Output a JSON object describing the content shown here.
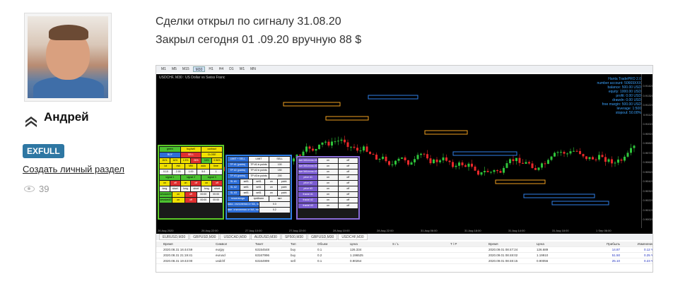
{
  "author": {
    "name": "Андрей",
    "badge": "EXFULL",
    "create_section_link": "Создать личный раздел",
    "views": "39"
  },
  "post": {
    "line1": "Сделки открыл по сигналу 31.08.20",
    "line2": "Закрыл сегодня 01 .09.20 вручную 88 $"
  },
  "terminal": {
    "timeframes": [
      "M1",
      "M5",
      "M15",
      "M30",
      "H1",
      "H4",
      "D1",
      "W1",
      "MN"
    ],
    "active_timeframe": "M30",
    "chart_title": "USDCHF, M30 : US Dollar vs Swiss Franc",
    "account_info": [
      "Hanta TradePRO 2.0",
      "number account: 50669XXX",
      "balance: 500.00 USD",
      "equity: 1000.00 USD",
      "profit: 0.00 USD",
      "drawdn: 0.00 USD",
      "free margin: 500.00 USD",
      "leverage: 1:500",
      "stopout: 50.00%"
    ],
    "y_ticks": [
      "0.91420",
      "0.91320",
      "0.91220",
      "0.91120",
      "0.91020",
      "0.90920",
      "0.90820",
      "0.90720",
      "0.90620",
      "0.90520",
      "0.90420",
      "0.90320",
      "0.90220",
      "0.90120",
      "0.90020"
    ],
    "x_ticks": [
      "26 Aug 2020",
      "26 Aug 22:00",
      "27 Aug 10:00",
      "27 Aug 22:00",
      "28 Aug 10:00",
      "28 Aug 22:00",
      "31 Aug 06:00",
      "31 Aug 18:00",
      "31 Aug 14:00",
      "31 Aug 18:00",
      "1 Sep 06:00"
    ],
    "symbol_tabs": [
      "EURUSD,M30",
      "GBPUSD,M30",
      "USDCAD,M30",
      "AUDUSD,M30",
      "SP500,M30",
      "GBPUSD,M30",
      "USDCHF,M30"
    ],
    "active_symbol_tab": "USDCHF,M30",
    "trades_header": [
      "Время",
      "Символ",
      "Тикет",
      "Тип",
      "Объем",
      "Цена",
      "S / L",
      "T / P",
      "Время",
      "Цена",
      "Прибыль",
      "Изменение"
    ],
    "trades": [
      [
        "2020.08.31 16:44:59",
        "eurjpy",
        "63154548",
        "buy",
        "0.1",
        "126.334",
        "",
        "",
        "2020.09.01 08:47:24",
        "126.689",
        "14.87",
        "0.12 %"
      ],
      [
        "2020.08.31 21:19:41",
        "eurusd",
        "63167996",
        "buy",
        "0.2",
        "1.196525",
        "",
        "",
        "2020.09.01 08:48:02",
        "1.19910",
        "51.50",
        "0.25 %"
      ],
      [
        "2020.08.31 19:43:00",
        "usdchf",
        "63164999",
        "sell",
        "0.1",
        "0.90264",
        "",
        "",
        "2020.09.01 08:48:15",
        "0.90056",
        "25.10",
        "0.23 %"
      ]
    ],
    "panel1": [
      [
        "green",
        "buy/sell",
        "contract"
      ],
      [
        "BUY",
        "SELL",
        "CLOSE"
      ],
      [
        "2k%",
        "1k%",
        "1.5%",
        "2k%",
        "1k%",
        "0.5k%"
      ],
      [
        "lot",
        "risk",
        "MM",
        "auto",
        "time"
      ],
      [
        "0.10",
        "2.00",
        "1.00",
        "5.0",
        "1"
      ],
      [
        "signal 1",
        "signal 2",
        "signal 3"
      ],
      [
        "on",
        "off",
        "on",
        "off",
        "on",
        "off"
      ],
      [
        "long",
        "short",
        "long",
        "short",
        "long",
        "short"
      ],
      [
        "session#1",
        "on",
        "off",
        "00:00",
        "00:00"
      ],
      [
        "session#2",
        "on",
        "off",
        "00:00",
        "00:00"
      ]
    ],
    "panel2": [
      [
        "LIMIT + SELL",
        "LIMIT",
        "SELL"
      ],
      [
        "TP #1 (points)",
        "TP #1 in points",
        "100"
      ],
      [
        "TP #2 (points)",
        "TP #2 in points",
        "150"
      ],
      [
        "TP #3 (points)",
        "TP #3 in points",
        "200"
      ],
      [
        "SL #1",
        "sell1",
        "sell1",
        "on",
        "point"
      ],
      [
        "SL #2",
        "sell1",
        "sell1",
        "on",
        "point"
      ],
      [
        "SL #3",
        "sell1",
        "sell1",
        "on",
        "point"
      ],
      [
        "точка входа",
        "трейлинг",
        "вкл"
      ],
      [
        "макс. отклонения от МА, пип",
        "0.3"
      ],
      [
        "мин. отклонения от МА, пип",
        "0.2"
      ]
    ],
    "panel3": [
      [
        "ave MA/cross #1",
        "on",
        "off"
      ],
      [
        "ave MA/cross #2",
        "on",
        "off"
      ],
      [
        "ave MA/cross #3",
        "on",
        "off"
      ],
      [
        "price #1",
        "on",
        "off"
      ],
      [
        "price #2",
        "on",
        "off"
      ],
      [
        "price #3",
        "on",
        "off"
      ],
      [
        "fractal #1",
        "on",
        "off"
      ],
      [
        "fractal #2",
        "on",
        "off"
      ],
      [
        "fractal #3",
        "on",
        "off"
      ]
    ]
  }
}
